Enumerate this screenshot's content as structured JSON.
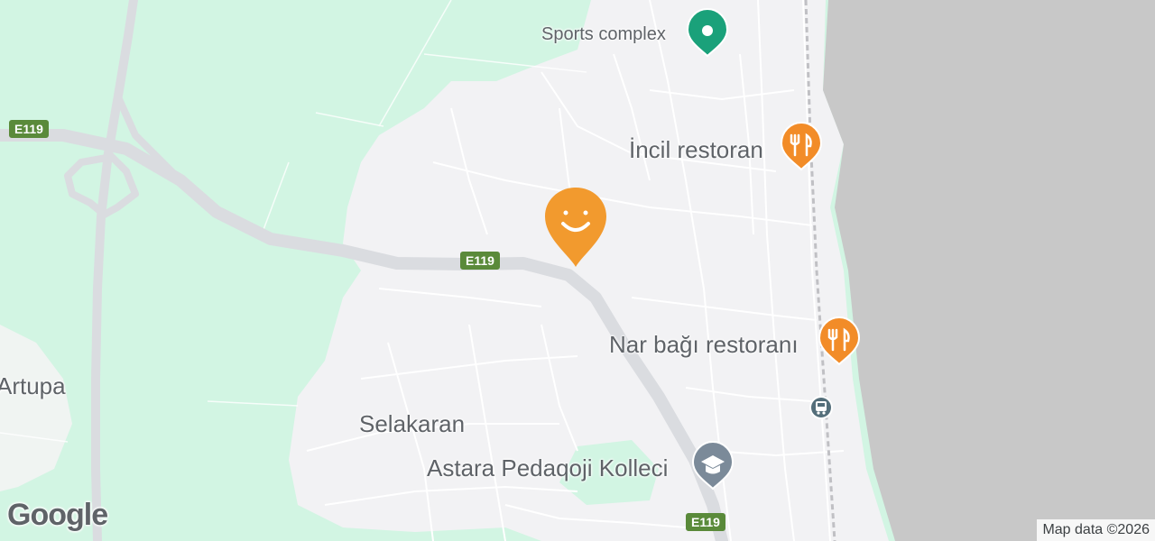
{
  "map": {
    "colors": {
      "land": "#f2f2f4",
      "park": "#d2f5e3",
      "water": "#c8c8c8",
      "road": "#ffffff",
      "highway": "#dadce0",
      "poi_food": "#f28c28",
      "poi_sports": "#1aa17a",
      "poi_school": "#7b8a99",
      "transit": "#546e7a",
      "shield": "#5a8a3a"
    },
    "places": {
      "selakaran": "Selakaran",
      "artupa": "Artupa"
    },
    "pois": {
      "sports_complex": {
        "label": "Sports complex",
        "icon": "sports-icon"
      },
      "incil_restoran": {
        "label": "İncil restoran",
        "icon": "restaurant-icon"
      },
      "nar_bagi": {
        "label": "Nar bağı restoranı",
        "icon": "restaurant-icon"
      },
      "college": {
        "label": "Astara Pedaqoji Kolleci",
        "icon": "school-icon"
      },
      "bus_stop": {
        "icon": "bus-stop-icon"
      },
      "selected": {
        "icon": "smiley-pin-icon"
      }
    },
    "road_shields": [
      "E119",
      "E119",
      "E119"
    ],
    "logo": "Google",
    "attribution": "Map data ©2026"
  }
}
